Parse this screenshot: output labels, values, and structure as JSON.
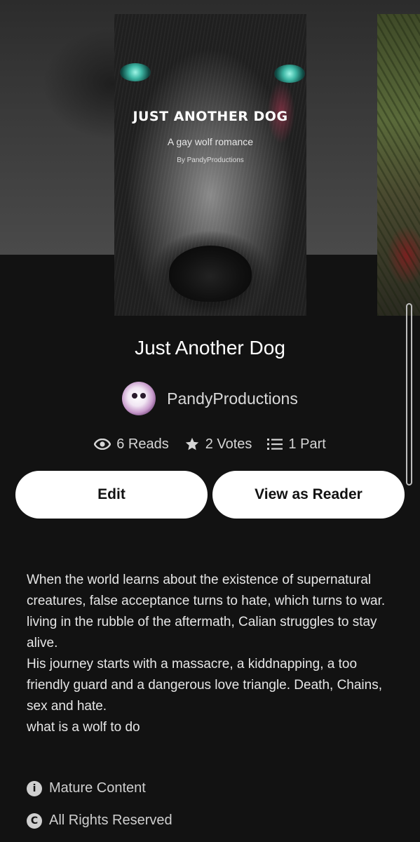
{
  "cover": {
    "title": "JUST ANOTHER DOG",
    "subtitle": "A gay wolf romance",
    "byline": "By PandyProductions"
  },
  "story": {
    "title": "Just Another Dog",
    "author": "PandyProductions"
  },
  "stats": {
    "reads": "6 Reads",
    "votes": "2 Votes",
    "parts": "1 Part"
  },
  "actions": {
    "edit_label": "Edit",
    "view_label": "View as Reader"
  },
  "description": [
    "When the world learns about the existence of supernatural creatures, false acceptance turns to hate, which turns to war.",
    "living in the rubble of the aftermath, Calian struggles to stay alive.",
    "His journey starts with a massacre, a kiddnapping, a too friendly guard and a dangerous love triangle. Death, Chains, sex and hate.",
    "what is a wolf to do"
  ],
  "meta": {
    "mature": "Mature Content",
    "rights": "All Rights Reserved"
  },
  "colors": {
    "background": "#121212",
    "button_bg": "#ffffff",
    "button_text": "#121212",
    "eye": "#3fb8a6"
  },
  "icons": {
    "reads": "eye-icon",
    "votes": "star-icon",
    "parts": "list-icon",
    "mature": "info-icon",
    "rights": "copyright-icon"
  }
}
